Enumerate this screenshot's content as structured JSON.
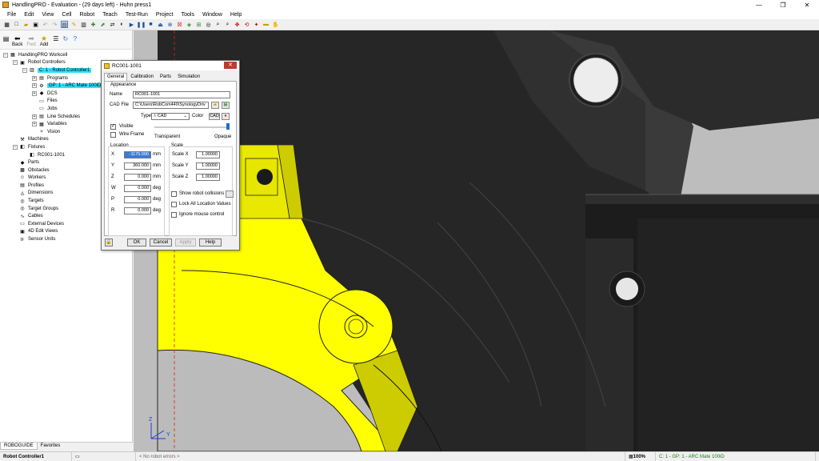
{
  "window": {
    "title": "HandlingPRO - Evaluation - (29 days left) - Huhn press1",
    "minimize": "—",
    "maximize": "❐",
    "close": "✕"
  },
  "menu": [
    "File",
    "Edit",
    "View",
    "Cell",
    "Robot",
    "Teach",
    "Test-Run",
    "Project",
    "Tools",
    "Window",
    "Help"
  ],
  "nav": {
    "back": "Back",
    "fwd": "Fwd",
    "add": "Add"
  },
  "tree": [
    {
      "label": "HandlingPRO Workcell",
      "indent": 0,
      "exp": "−",
      "icon": "workcell-icon"
    },
    {
      "label": "Robot Controllers",
      "indent": 1,
      "exp": "−",
      "icon": "controller-icon"
    },
    {
      "label": "C: 1 - Robot Controller1",
      "indent": 2,
      "exp": "−",
      "icon": "robot-controller-icon",
      "hl": true
    },
    {
      "label": "Programs",
      "indent": 3,
      "exp": "+",
      "icon": "programs-icon"
    },
    {
      "label": "GP: 1 - ARC Mate 100iD",
      "indent": 3,
      "exp": "+",
      "icon": "robot-icon",
      "hl": true
    },
    {
      "label": "DCS",
      "indent": 3,
      "exp": "+",
      "icon": "dcs-icon"
    },
    {
      "label": "Files",
      "indent": 3,
      "exp": "",
      "icon": "files-icon"
    },
    {
      "label": "Jobs",
      "indent": 3,
      "exp": "",
      "icon": "jobs-icon"
    },
    {
      "label": "Line Schedules",
      "indent": 3,
      "exp": "+",
      "icon": "schedule-icon"
    },
    {
      "label": "Variables",
      "indent": 3,
      "exp": "+",
      "icon": "variables-icon"
    },
    {
      "label": "Vision",
      "indent": 3,
      "exp": "",
      "icon": "vision-icon"
    },
    {
      "label": "Machines",
      "indent": 1,
      "exp": "",
      "icon": "machines-icon"
    },
    {
      "label": "Fixtures",
      "indent": 1,
      "exp": "−",
      "icon": "fixtures-icon"
    },
    {
      "label": "RC001-1001",
      "indent": 2,
      "exp": "",
      "icon": "fixture-icon"
    },
    {
      "label": "Parts",
      "indent": 1,
      "exp": "",
      "icon": "parts-icon"
    },
    {
      "label": "Obstacles",
      "indent": 1,
      "exp": "",
      "icon": "obstacles-icon"
    },
    {
      "label": "Workers",
      "indent": 1,
      "exp": "",
      "icon": "workers-icon"
    },
    {
      "label": "Profiles",
      "indent": 1,
      "exp": "",
      "icon": "profiles-icon"
    },
    {
      "label": "Dimensions",
      "indent": 1,
      "exp": "",
      "icon": "dimensions-icon"
    },
    {
      "label": "Targets",
      "indent": 1,
      "exp": "",
      "icon": "targets-icon"
    },
    {
      "label": "Target Groups",
      "indent": 1,
      "exp": "",
      "icon": "target-groups-icon"
    },
    {
      "label": "Cables",
      "indent": 1,
      "exp": "",
      "icon": "cables-icon"
    },
    {
      "label": "External Devices",
      "indent": 1,
      "exp": "",
      "icon": "external-devices-icon"
    },
    {
      "label": "4D Edit Views",
      "indent": 1,
      "exp": "",
      "icon": "4d-views-icon"
    },
    {
      "label": "Sensor Units",
      "indent": 1,
      "exp": "",
      "icon": "sensor-icon"
    }
  ],
  "bottom_tabs": [
    "ROBOGUIDE",
    "Favorites"
  ],
  "status": {
    "controller": "Robot Controller1",
    "errors": "< No robot errors >",
    "zoom": "100%",
    "group": "C: 1 - GP: 1 - ARC Mate 100iD"
  },
  "dialog": {
    "title": "RC001-1001",
    "tabs": [
      "General",
      "Calibration",
      "Parts",
      "Simulation"
    ],
    "appearance_label": "Appearance",
    "name_label": "Name",
    "name_value": "RC001-1001",
    "cad_label": "CAD File",
    "cad_value": "C:\\Users\\RobCom440\\SynologyDriv",
    "type_label": "Type",
    "type_value": "CAD",
    "color_label": "Color",
    "cad_btn": "CAD",
    "visible_label": "Visible",
    "visible_checked": true,
    "wireframe_label": "Wire Frame",
    "wireframe_checked": false,
    "transparent_label": "Transparent",
    "opaque_label": "Opaque",
    "location_label": "Location",
    "scale_label": "Scale",
    "loc": [
      {
        "axis": "X",
        "value": "-1175.000",
        "unit": "mm"
      },
      {
        "axis": "Y",
        "value": "360.000",
        "unit": "mm"
      },
      {
        "axis": "Z",
        "value": "0.000",
        "unit": "mm"
      },
      {
        "axis": "W",
        "value": "0.000",
        "unit": "deg"
      },
      {
        "axis": "P",
        "value": "0.000",
        "unit": "deg"
      },
      {
        "axis": "R",
        "value": "0.000",
        "unit": "deg"
      }
    ],
    "scale": [
      {
        "axis": "Scale X",
        "value": "1.00000"
      },
      {
        "axis": "Scale Y",
        "value": "1.00000"
      },
      {
        "axis": "Scale Z",
        "value": "1.00000"
      }
    ],
    "show_collisions_label": "Show robot collisions",
    "lock_label": "Lock All Location Values",
    "ignore_mouse_label": "Ignore mouse control",
    "buttons": {
      "ok": "OK",
      "cancel": "Cancel",
      "apply": "Apply",
      "help": "Help"
    }
  },
  "viewport": {
    "axis_y": "Y",
    "axis_z": "Z"
  }
}
